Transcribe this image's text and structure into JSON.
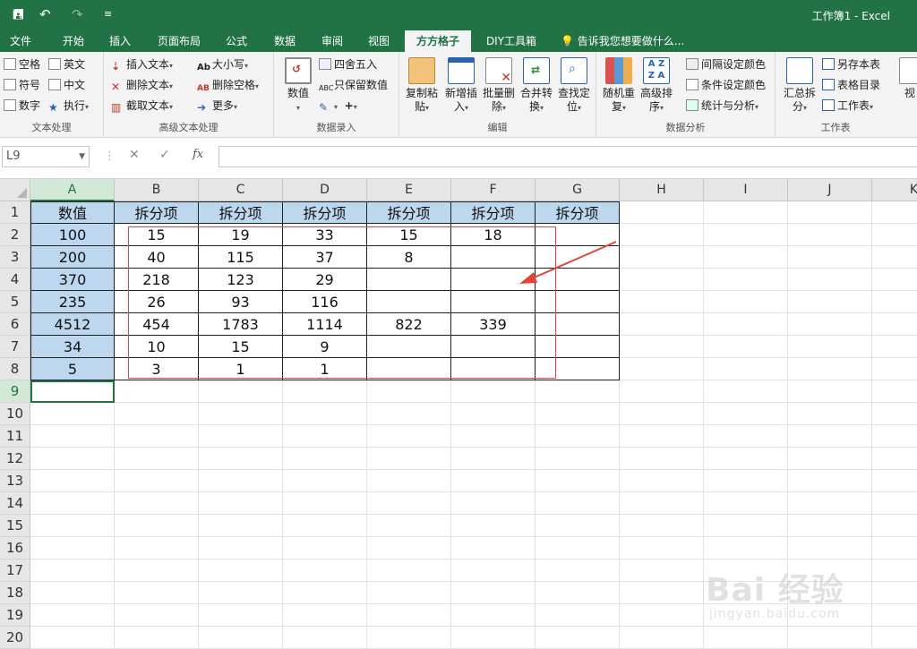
{
  "window": {
    "title": "工作簿1 - Excel"
  },
  "quick_access": {
    "save_icon": "save-icon",
    "undo_icon": "undo-icon",
    "redo_icon": "redo-icon",
    "customize_icon": "customize-icon"
  },
  "tabs": [
    "文件",
    "开始",
    "插入",
    "页面布局",
    "公式",
    "数据",
    "审阅",
    "视图",
    "方方格子",
    "DIY工具箱"
  ],
  "active_tab": "方方格子",
  "tell_me": "告诉我您想要做什么...",
  "ribbon": {
    "text_group": {
      "label": "文本处理",
      "items": [
        "空格",
        "英文",
        "符号",
        "中文",
        "数字",
        "执行"
      ]
    },
    "adv_text_group": {
      "label": "高级文本处理",
      "items": [
        "插入文本",
        "大小写",
        "删除文本",
        "删除空格",
        "截取文本",
        "更多"
      ]
    },
    "data_entry_group": {
      "label": "数据录入",
      "items": [
        "数值",
        "四舍五入",
        "只保留数值"
      ]
    },
    "edit_group": {
      "label": "编辑",
      "items": [
        "复制粘贴",
        "新增插入",
        "批量删除",
        "合并转换",
        "查找定位"
      ]
    },
    "analysis_group": {
      "label": "数据分析",
      "items": [
        "随机重复",
        "高级排序",
        "间隔设定颜色",
        "条件设定颜色",
        "统计与分析"
      ]
    },
    "worksheet_group": {
      "label": "工作表",
      "items": [
        "汇总拆分",
        "另存本表",
        "表格目录",
        "工作表",
        "视"
      ]
    }
  },
  "formula_bar": {
    "name_box": "L9",
    "cancel": "✕",
    "enter": "✓",
    "fx": "fx",
    "formula": ""
  },
  "columns": [
    "A",
    "B",
    "C",
    "D",
    "E",
    "F",
    "G",
    "H",
    "I",
    "J",
    "K"
  ],
  "selected_column": "A",
  "rows": [
    "1",
    "2",
    "3",
    "4",
    "5",
    "6",
    "7",
    "8",
    "9",
    "10",
    "11",
    "12",
    "13",
    "14",
    "15",
    "16",
    "17",
    "18",
    "19",
    "20"
  ],
  "selected_row": "9",
  "sheet": [
    [
      "数值",
      "拆分项",
      "拆分项",
      "拆分项",
      "拆分项",
      "拆分项",
      "拆分项"
    ],
    [
      "100",
      "15",
      "19",
      "33",
      "15",
      "18",
      ""
    ],
    [
      "200",
      "40",
      "115",
      "37",
      "8",
      "",
      ""
    ],
    [
      "370",
      "218",
      "123",
      "29",
      "",
      "",
      ""
    ],
    [
      "235",
      "26",
      "93",
      "116",
      "",
      "",
      ""
    ],
    [
      "4512",
      "454",
      "1783",
      "1114",
      "822",
      "339",
      ""
    ],
    [
      "34",
      "10",
      "15",
      "9",
      "",
      "",
      ""
    ],
    [
      "5",
      "3",
      "1",
      "1",
      "",
      "",
      ""
    ]
  ],
  "watermark": {
    "brand": "Bai 经验",
    "url": "jingyan.baidu.com"
  },
  "colors": {
    "excel_green": "#217346",
    "header_fill": "#bdd7ee",
    "annotation_red": "#e0453b"
  }
}
